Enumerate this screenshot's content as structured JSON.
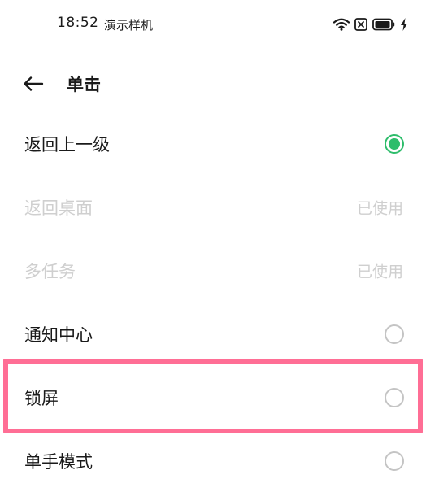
{
  "status_bar": {
    "time": "18:52",
    "carrier": "演示样机",
    "icons": [
      "wifi-icon",
      "sim-x-icon",
      "battery-icon",
      "charging-bolt-icon"
    ]
  },
  "header": {
    "title": "单击",
    "back_icon": "arrow-left-icon"
  },
  "options": [
    {
      "label": "返回上一级",
      "state": "selected"
    },
    {
      "label": "返回桌面",
      "state": "disabled",
      "status": "已使用"
    },
    {
      "label": "多任务",
      "state": "disabled",
      "status": "已使用"
    },
    {
      "label": "通知中心",
      "state": "unselected"
    },
    {
      "label": "锁屏",
      "state": "unselected",
      "highlighted": true
    },
    {
      "label": "单手模式",
      "state": "unselected"
    }
  ],
  "colors": {
    "accent_green": "#2ebd6b",
    "highlight_pink": "#ff6e95",
    "disabled_text": "#cfcfcf"
  }
}
